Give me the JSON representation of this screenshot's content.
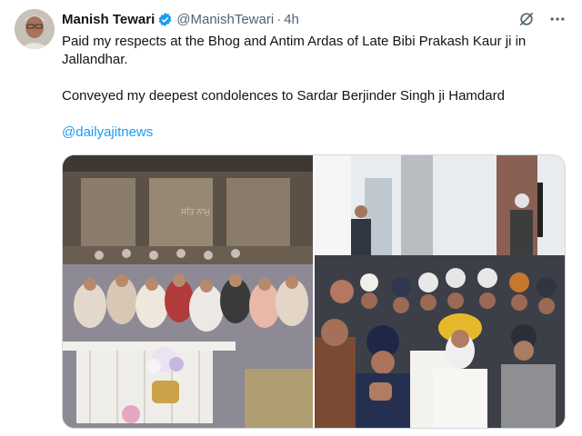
{
  "author": {
    "name": "Manish Tewari",
    "handle": "@ManishTewari",
    "separator": "·",
    "time": "4h"
  },
  "tweet": {
    "line1": "Paid my respects at the Bhog and Antim Ardas of Late Bibi Prakash Kaur ji in Jallandhar.",
    "line2": "Conveyed my deepest condolences to Sardar Berjinder Singh ji Hamdard",
    "mention": "@dailyajitnews"
  },
  "icons": {
    "verified": "verified-badge-icon",
    "grok": "grok-icon",
    "more": "more-icon"
  },
  "colors": {
    "accent": "#1d9bf0",
    "text": "#0f1419",
    "muted": "#536471"
  },
  "media": {
    "photos": [
      {
        "name": "left-photo"
      },
      {
        "name": "right-photo"
      }
    ]
  }
}
